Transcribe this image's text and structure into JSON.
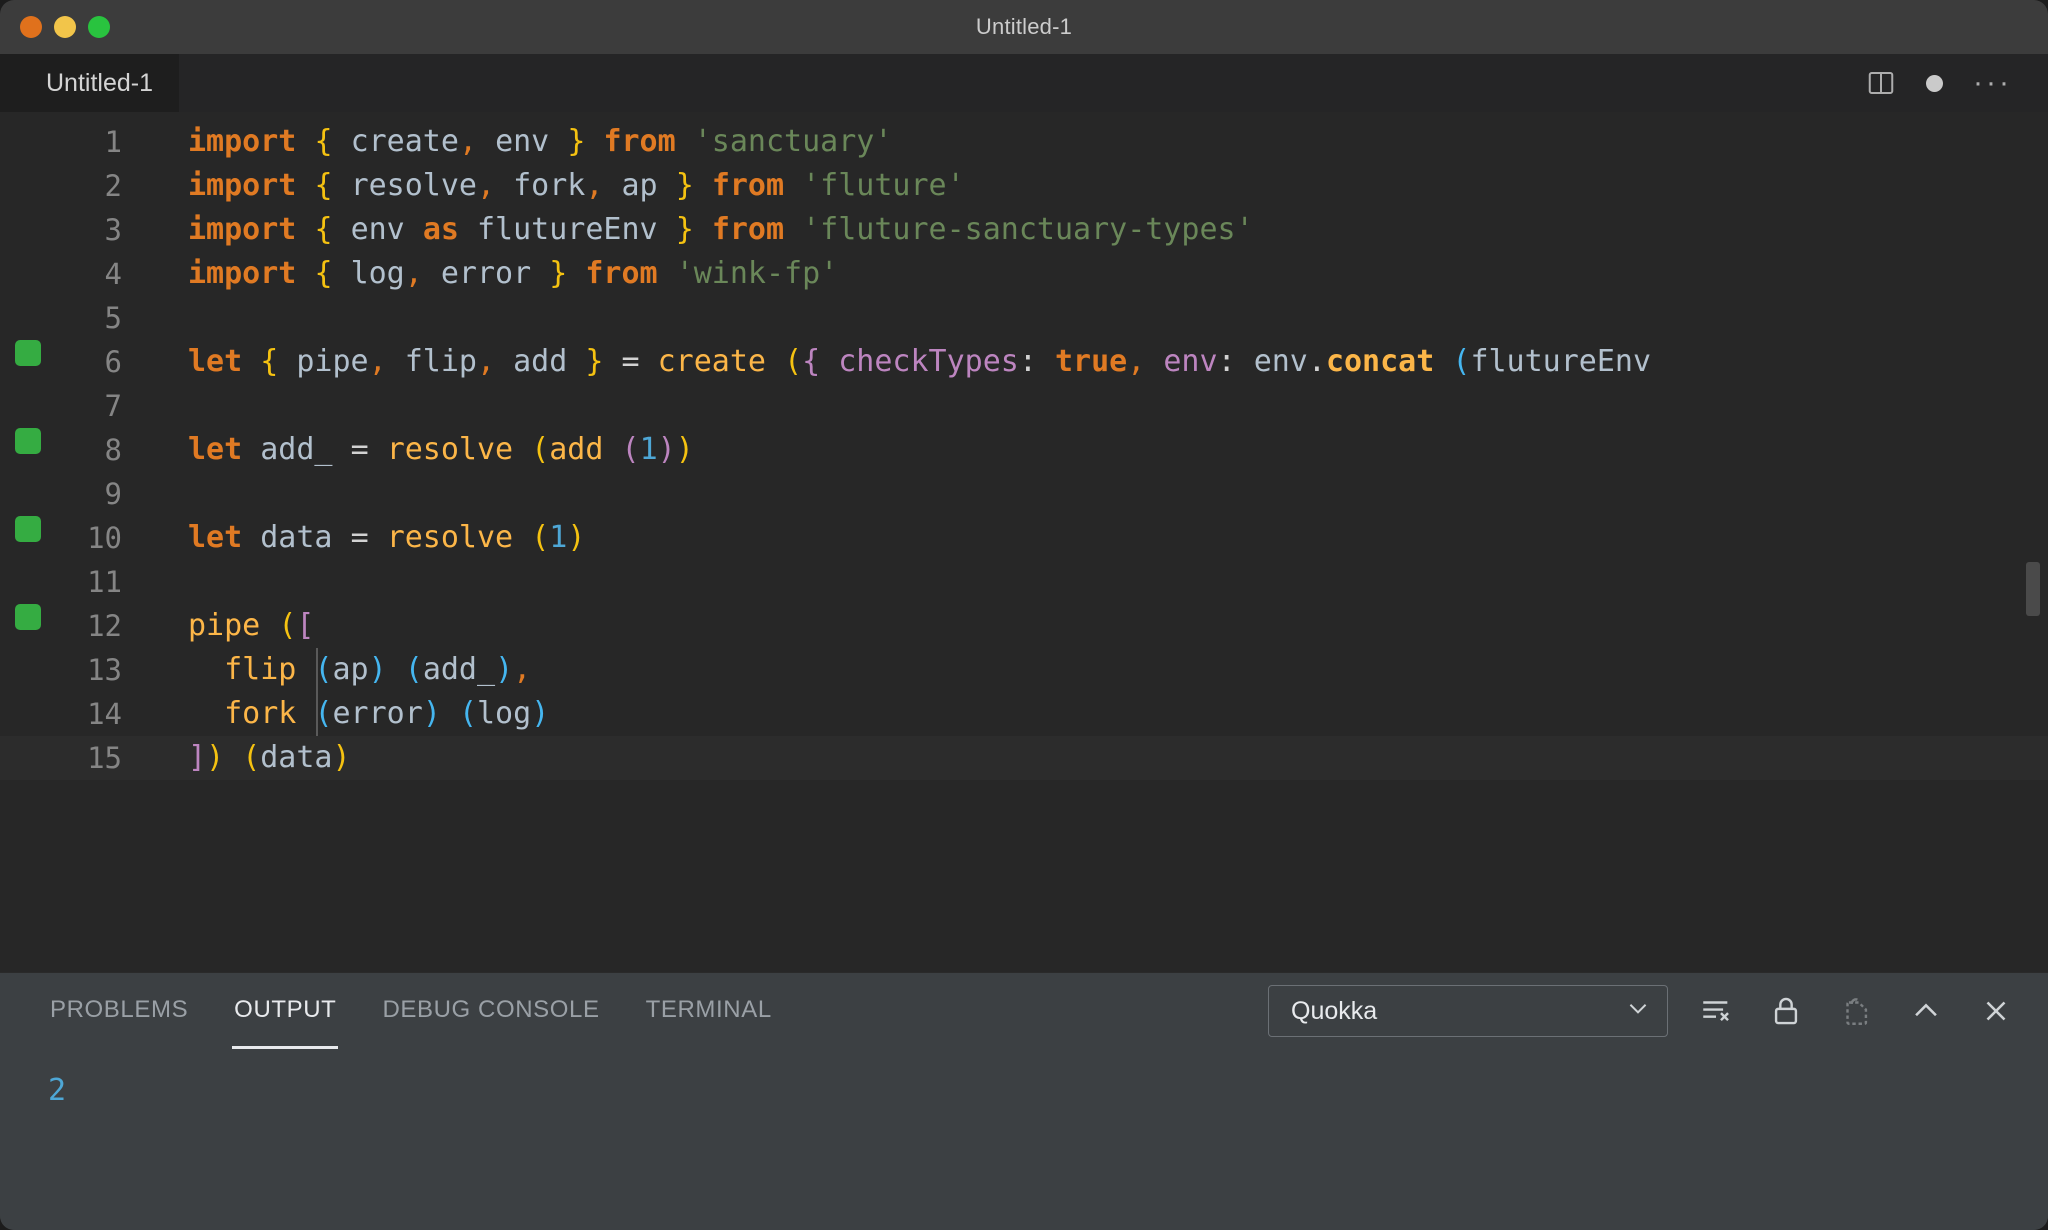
{
  "window": {
    "title": "Untitled-1",
    "traffic_lights": [
      "close",
      "minimize",
      "maximize"
    ]
  },
  "editor_tab": {
    "label": "Untitled-1",
    "split_icon": "split-editor-icon",
    "unsaved_icon": "unsaved-dot-icon",
    "more_icon": "more-actions-icon"
  },
  "code": {
    "language": "javascript",
    "lines": [
      {
        "n": "1",
        "covered": false,
        "indent_guide": false,
        "cursor": false,
        "tokens": [
          {
            "t": "import",
            "c": "kw"
          },
          {
            "t": " ",
            "c": "op"
          },
          {
            "t": "{",
            "c": "br-y"
          },
          {
            "t": " ",
            "c": "op"
          },
          {
            "t": "create",
            "c": "var"
          },
          {
            "t": ",",
            "c": "comma-o"
          },
          {
            "t": " ",
            "c": "op"
          },
          {
            "t": "env",
            "c": "var"
          },
          {
            "t": " ",
            "c": "op"
          },
          {
            "t": "}",
            "c": "br-y"
          },
          {
            "t": " ",
            "c": "op"
          },
          {
            "t": "from",
            "c": "kw"
          },
          {
            "t": " ",
            "c": "op"
          },
          {
            "t": "'sanctuary'",
            "c": "str"
          }
        ]
      },
      {
        "n": "2",
        "covered": false,
        "indent_guide": false,
        "cursor": false,
        "tokens": [
          {
            "t": "import",
            "c": "kw"
          },
          {
            "t": " ",
            "c": "op"
          },
          {
            "t": "{",
            "c": "br-y"
          },
          {
            "t": " ",
            "c": "op"
          },
          {
            "t": "resolve",
            "c": "var"
          },
          {
            "t": ",",
            "c": "comma-o"
          },
          {
            "t": " ",
            "c": "op"
          },
          {
            "t": "fork",
            "c": "var"
          },
          {
            "t": ",",
            "c": "comma-o"
          },
          {
            "t": " ",
            "c": "op"
          },
          {
            "t": "ap",
            "c": "var"
          },
          {
            "t": " ",
            "c": "op"
          },
          {
            "t": "}",
            "c": "br-y"
          },
          {
            "t": " ",
            "c": "op"
          },
          {
            "t": "from",
            "c": "kw"
          },
          {
            "t": " ",
            "c": "op"
          },
          {
            "t": "'fluture'",
            "c": "str"
          }
        ]
      },
      {
        "n": "3",
        "covered": false,
        "indent_guide": false,
        "cursor": false,
        "tokens": [
          {
            "t": "import",
            "c": "kw"
          },
          {
            "t": " ",
            "c": "op"
          },
          {
            "t": "{",
            "c": "br-y"
          },
          {
            "t": " ",
            "c": "op"
          },
          {
            "t": "env",
            "c": "var"
          },
          {
            "t": " ",
            "c": "op"
          },
          {
            "t": "as",
            "c": "kw"
          },
          {
            "t": " ",
            "c": "op"
          },
          {
            "t": "flutureEnv",
            "c": "var"
          },
          {
            "t": " ",
            "c": "op"
          },
          {
            "t": "}",
            "c": "br-y"
          },
          {
            "t": " ",
            "c": "op"
          },
          {
            "t": "from",
            "c": "kw"
          },
          {
            "t": " ",
            "c": "op"
          },
          {
            "t": "'fluture-sanctuary-types'",
            "c": "str"
          }
        ]
      },
      {
        "n": "4",
        "covered": false,
        "indent_guide": false,
        "cursor": false,
        "tokens": [
          {
            "t": "import",
            "c": "kw"
          },
          {
            "t": " ",
            "c": "op"
          },
          {
            "t": "{",
            "c": "br-y"
          },
          {
            "t": " ",
            "c": "op"
          },
          {
            "t": "log",
            "c": "var"
          },
          {
            "t": ",",
            "c": "comma-o"
          },
          {
            "t": " ",
            "c": "op"
          },
          {
            "t": "error",
            "c": "var"
          },
          {
            "t": " ",
            "c": "op"
          },
          {
            "t": "}",
            "c": "br-y"
          },
          {
            "t": " ",
            "c": "op"
          },
          {
            "t": "from",
            "c": "kw"
          },
          {
            "t": " ",
            "c": "op"
          },
          {
            "t": "'wink-fp'",
            "c": "str"
          }
        ]
      },
      {
        "n": "5",
        "covered": false,
        "indent_guide": false,
        "cursor": false,
        "tokens": []
      },
      {
        "n": "6",
        "covered": true,
        "indent_guide": false,
        "cursor": false,
        "tokens": [
          {
            "t": "let",
            "c": "kw"
          },
          {
            "t": " ",
            "c": "op"
          },
          {
            "t": "{",
            "c": "br-y"
          },
          {
            "t": " ",
            "c": "op"
          },
          {
            "t": "pipe",
            "c": "var"
          },
          {
            "t": ",",
            "c": "comma-o"
          },
          {
            "t": " ",
            "c": "op"
          },
          {
            "t": "flip",
            "c": "var"
          },
          {
            "t": ",",
            "c": "comma-o"
          },
          {
            "t": " ",
            "c": "op"
          },
          {
            "t": "add",
            "c": "var"
          },
          {
            "t": " ",
            "c": "op"
          },
          {
            "t": "}",
            "c": "br-y"
          },
          {
            "t": " ",
            "c": "op"
          },
          {
            "t": "=",
            "c": "op"
          },
          {
            "t": " ",
            "c": "op"
          },
          {
            "t": "create",
            "c": "callee"
          },
          {
            "t": " ",
            "c": "op"
          },
          {
            "t": "(",
            "c": "br-y"
          },
          {
            "t": "{",
            "c": "br-p"
          },
          {
            "t": " ",
            "c": "op"
          },
          {
            "t": "checkTypes",
            "c": "prop"
          },
          {
            "t": ":",
            "c": "op"
          },
          {
            "t": " ",
            "c": "op"
          },
          {
            "t": "true",
            "c": "kw"
          },
          {
            "t": ",",
            "c": "comma-o"
          },
          {
            "t": " ",
            "c": "op"
          },
          {
            "t": "env",
            "c": "prop"
          },
          {
            "t": ":",
            "c": "op"
          },
          {
            "t": " ",
            "c": "op"
          },
          {
            "t": "env",
            "c": "var"
          },
          {
            "t": ".",
            "c": "op"
          },
          {
            "t": "concat",
            "c": "method"
          },
          {
            "t": " ",
            "c": "op"
          },
          {
            "t": "(",
            "c": "br-b"
          },
          {
            "t": "flutureEnv",
            "c": "var"
          }
        ]
      },
      {
        "n": "7",
        "covered": false,
        "indent_guide": false,
        "cursor": false,
        "tokens": []
      },
      {
        "n": "8",
        "covered": true,
        "indent_guide": false,
        "cursor": false,
        "tokens": [
          {
            "t": "let",
            "c": "kw"
          },
          {
            "t": " ",
            "c": "op"
          },
          {
            "t": "add_",
            "c": "var"
          },
          {
            "t": " ",
            "c": "op"
          },
          {
            "t": "=",
            "c": "op"
          },
          {
            "t": " ",
            "c": "op"
          },
          {
            "t": "resolve",
            "c": "callee"
          },
          {
            "t": " ",
            "c": "op"
          },
          {
            "t": "(",
            "c": "br-y"
          },
          {
            "t": "add",
            "c": "callee"
          },
          {
            "t": " ",
            "c": "op"
          },
          {
            "t": "(",
            "c": "br-p"
          },
          {
            "t": "1",
            "c": "num"
          },
          {
            "t": ")",
            "c": "br-p"
          },
          {
            "t": ")",
            "c": "br-y"
          }
        ]
      },
      {
        "n": "9",
        "covered": false,
        "indent_guide": false,
        "cursor": false,
        "tokens": []
      },
      {
        "n": "10",
        "covered": true,
        "indent_guide": false,
        "cursor": false,
        "tokens": [
          {
            "t": "let",
            "c": "kw"
          },
          {
            "t": " ",
            "c": "op"
          },
          {
            "t": "data",
            "c": "var"
          },
          {
            "t": " ",
            "c": "op"
          },
          {
            "t": "=",
            "c": "op"
          },
          {
            "t": " ",
            "c": "op"
          },
          {
            "t": "resolve",
            "c": "callee"
          },
          {
            "t": " ",
            "c": "op"
          },
          {
            "t": "(",
            "c": "br-y"
          },
          {
            "t": "1",
            "c": "num"
          },
          {
            "t": ")",
            "c": "br-y"
          }
        ]
      },
      {
        "n": "11",
        "covered": false,
        "indent_guide": false,
        "cursor": false,
        "tokens": []
      },
      {
        "n": "12",
        "covered": true,
        "indent_guide": false,
        "cursor": false,
        "tokens": [
          {
            "t": "pipe",
            "c": "callee"
          },
          {
            "t": " ",
            "c": "op"
          },
          {
            "t": "(",
            "c": "br-y"
          },
          {
            "t": "[",
            "c": "br-p"
          }
        ]
      },
      {
        "n": "13",
        "covered": false,
        "indent_guide": true,
        "cursor": false,
        "tokens": [
          {
            "t": "  ",
            "c": "op"
          },
          {
            "t": "flip",
            "c": "callee"
          },
          {
            "t": " ",
            "c": "op"
          },
          {
            "t": "(",
            "c": "br-b"
          },
          {
            "t": "ap",
            "c": "var"
          },
          {
            "t": ")",
            "c": "br-b"
          },
          {
            "t": " ",
            "c": "op"
          },
          {
            "t": "(",
            "c": "br-b"
          },
          {
            "t": "add_",
            "c": "var"
          },
          {
            "t": ")",
            "c": "br-b"
          },
          {
            "t": ",",
            "c": "comma-o"
          }
        ]
      },
      {
        "n": "14",
        "covered": false,
        "indent_guide": true,
        "cursor": false,
        "tokens": [
          {
            "t": "  ",
            "c": "op"
          },
          {
            "t": "fork",
            "c": "callee"
          },
          {
            "t": " ",
            "c": "op"
          },
          {
            "t": "(",
            "c": "br-b"
          },
          {
            "t": "error",
            "c": "var"
          },
          {
            "t": ")",
            "c": "br-b"
          },
          {
            "t": " ",
            "c": "op"
          },
          {
            "t": "(",
            "c": "br-b"
          },
          {
            "t": "log",
            "c": "var"
          },
          {
            "t": ")",
            "c": "br-b"
          }
        ]
      },
      {
        "n": "15",
        "covered": false,
        "indent_guide": false,
        "cursor": true,
        "tokens": [
          {
            "t": "]",
            "c": "br-p"
          },
          {
            "t": ")",
            "c": "br-y"
          },
          {
            "t": " ",
            "c": "op"
          },
          {
            "t": "(",
            "c": "br-y"
          },
          {
            "t": "data",
            "c": "var"
          },
          {
            "t": ")",
            "c": "br-y"
          }
        ]
      }
    ]
  },
  "panel": {
    "tabs": [
      {
        "label": "PROBLEMS",
        "active": false
      },
      {
        "label": "OUTPUT",
        "active": true
      },
      {
        "label": "DEBUG CONSOLE",
        "active": false
      },
      {
        "label": "TERMINAL",
        "active": false
      }
    ],
    "channel_select": {
      "value": "Quokka",
      "chevron": "chevron-down-icon"
    },
    "actions": [
      {
        "name": "clear-output-icon",
        "dim": false
      },
      {
        "name": "lock-scroll-icon",
        "dim": false
      },
      {
        "name": "open-in-editor-icon",
        "dim": true
      },
      {
        "name": "maximize-panel-icon",
        "dim": false
      },
      {
        "name": "close-panel-icon",
        "dim": false
      }
    ],
    "output_text": "2"
  },
  "colors": {
    "keyword": "#e07a23",
    "function": "#fcb648",
    "string": "#6a8759",
    "number": "#4ea7d6",
    "property": "#bd85c0",
    "variable": "#b2c0cd",
    "bracket_yellow": "#f5c211",
    "bracket_purple": "#bd85c0",
    "bracket_blue": "#45b6f0",
    "coverage_green": "#35ac42",
    "editor_bg": "#272727",
    "panel_bg": "#3c4043"
  }
}
